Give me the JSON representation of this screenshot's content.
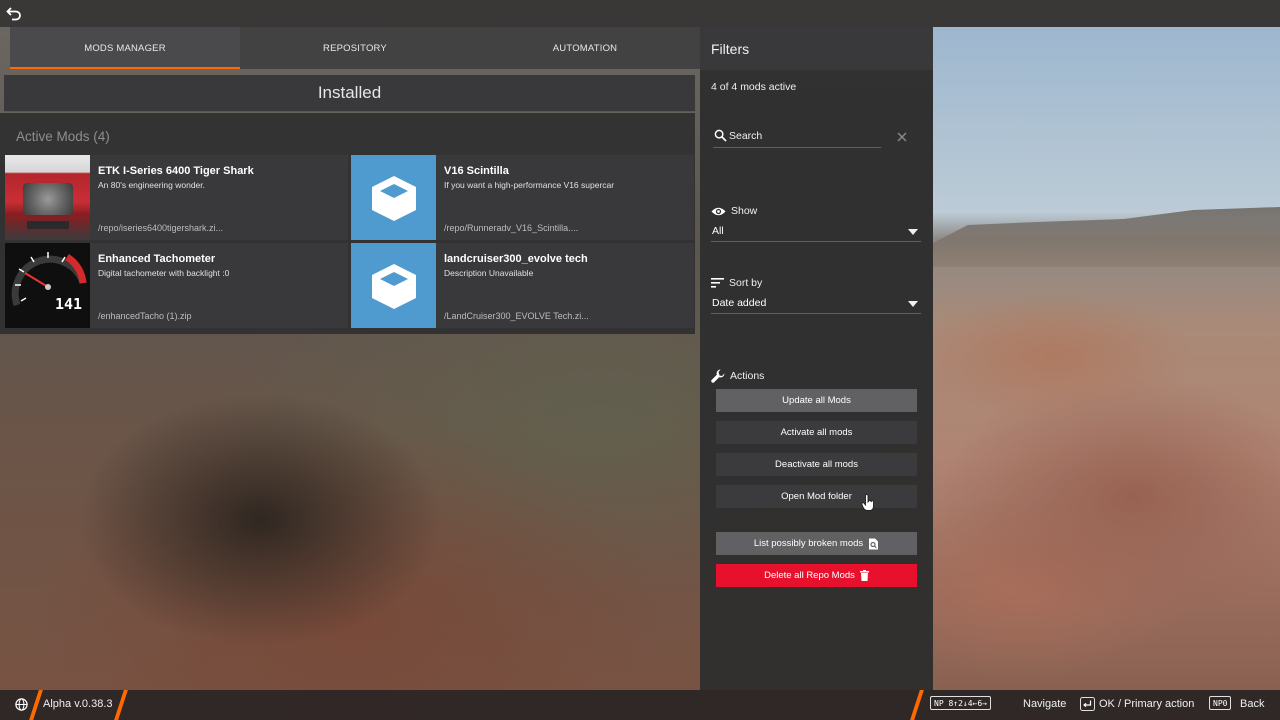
{
  "tabs": [
    {
      "label": "MODS MANAGER",
      "active": true
    },
    {
      "label": "REPOSITORY",
      "active": false
    },
    {
      "label": "AUTOMATION",
      "active": false
    }
  ],
  "main": {
    "header": "Installed",
    "section_label": "Active Mods (4)",
    "mods": [
      {
        "title": "ETK I-Series 6400 Tiger Shark",
        "description": "An 80's engineering wonder.",
        "path": "/repo/iseries6400tigershark.zi...",
        "thumbnail": "car-photo"
      },
      {
        "title": "V16 Scintilla",
        "description": "If you want a high-performance V16 supercar",
        "path": "/repo/Runneradv_V16_Scintilla....",
        "thumbnail": "box-icon"
      },
      {
        "title": "Enhanced Tachometer",
        "description": "Digital tachometer with backlight :0",
        "path": "/enhancedTacho (1).zip",
        "thumbnail": "tachometer-photo"
      },
      {
        "title": "landcruiser300_evolve tech",
        "description": "Description Unavailable",
        "path": "/LandCruiser300_EVOLVE Tech.zi...",
        "thumbnail": "box-icon"
      }
    ],
    "tacho_readout": "141"
  },
  "filters": {
    "title": "Filters",
    "active_count": "4 of 4 mods active",
    "search_placeholder": "Search",
    "show_label": "Show",
    "show_value": "All",
    "sort_label": "Sort by",
    "sort_value": "Date added",
    "actions_label": "Actions",
    "actions": {
      "update": "Update all Mods",
      "activate": "Activate all mods",
      "deactivate": "Deactivate all mods",
      "open_folder": "Open Mod folder",
      "list_broken": "List possibly broken mods",
      "delete_repo": "Delete all Repo Mods"
    }
  },
  "bottom": {
    "version": "Alpha v.0.38.3",
    "navigate_keys": "NP 8↑2↓4←6→",
    "navigate_label": "Navigate",
    "ok_label": "OK / Primary action",
    "back_key": "NP0",
    "back_label": "Back"
  },
  "colors": {
    "accent": "#ff6a00",
    "danger": "#e8112d",
    "thumb_blue": "#4f9bd0"
  }
}
